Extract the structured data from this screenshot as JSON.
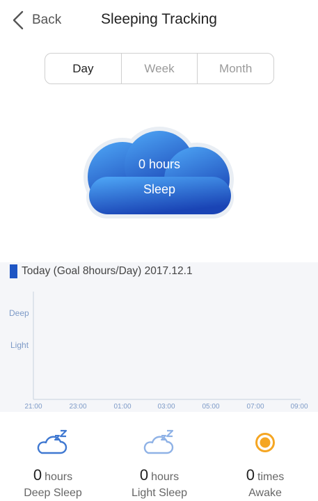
{
  "header": {
    "back_label": "Back",
    "title": "Sleeping Tracking"
  },
  "tabs": [
    {
      "label": "Day",
      "active": true
    },
    {
      "label": "Week",
      "active": false
    },
    {
      "label": "Month",
      "active": false
    }
  ],
  "summary": {
    "value_text": "0 hours",
    "label": "Sleep"
  },
  "chart": {
    "heading": "Today (Goal 8hours/Day) 2017.12.1",
    "y_labels": [
      "Deep",
      "Light"
    ],
    "x_ticks": [
      "21:00",
      "23:00",
      "01:00",
      "03:00",
      "05:00",
      "07:00",
      "09:00"
    ]
  },
  "chart_data": {
    "type": "bar",
    "title": "Today (Goal 8hours/Day) 2017.12.1",
    "categories": [
      "21:00",
      "23:00",
      "01:00",
      "03:00",
      "05:00",
      "07:00",
      "09:00"
    ],
    "y_categories": [
      "Deep",
      "Light"
    ],
    "values": [],
    "grid": false
  },
  "stats": [
    {
      "icon": "deep-sleep-cloud-icon",
      "value": "0",
      "unit": "hours",
      "label": "Deep Sleep"
    },
    {
      "icon": "light-sleep-cloud-icon",
      "value": "0",
      "unit": "hours",
      "label": "Light Sleep"
    },
    {
      "icon": "awake-sun-icon",
      "value": "0",
      "unit": "times",
      "label": "Awake"
    }
  ],
  "colors": {
    "accent_blue": "#1f56c4",
    "cloud_light": "#4aa3f5",
    "cloud_dark": "#1a45b8",
    "awake_orange": "#f5a623",
    "axis_label": "#7d9ac7"
  }
}
